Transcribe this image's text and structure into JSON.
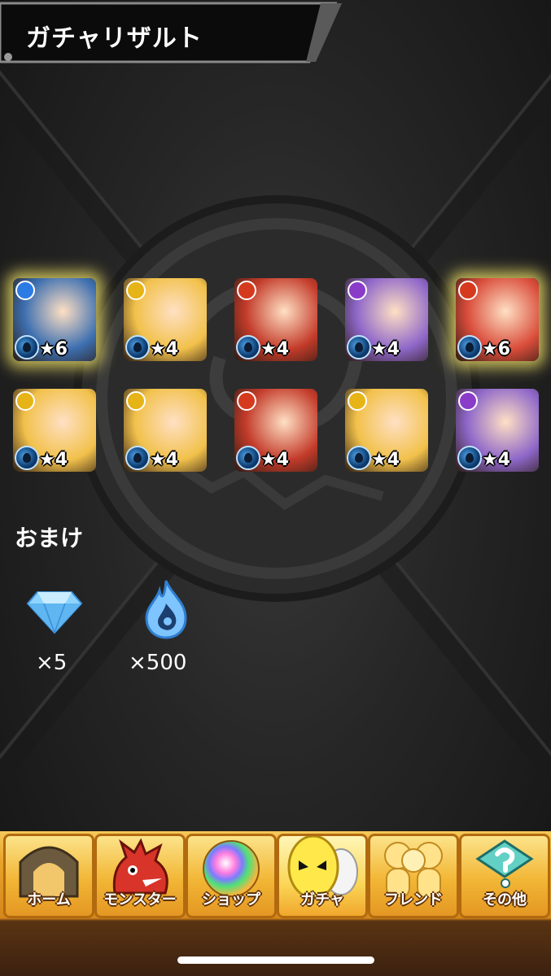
{
  "header": {
    "title": "ガチャリザルト"
  },
  "results": [
    {
      "rarity": "★6",
      "attribute": "water",
      "attr_color": "#2c7be5",
      "bg": "#3d6fb0",
      "glow": true
    },
    {
      "rarity": "★4",
      "attribute": "light",
      "attr_color": "#e6b416",
      "bg": "#f2c14b",
      "glow": false
    },
    {
      "rarity": "★4",
      "attribute": "fire",
      "attr_color": "#d63a1e",
      "bg": "#c33b2a",
      "glow": false
    },
    {
      "rarity": "★4",
      "attribute": "dark",
      "attr_color": "#8a3cc9",
      "bg": "#8e67c9",
      "glow": false
    },
    {
      "rarity": "★6",
      "attribute": "fire",
      "attr_color": "#d63a1e",
      "bg": "#d94c3a",
      "glow": true
    },
    {
      "rarity": "★4",
      "attribute": "light",
      "attr_color": "#e6b416",
      "bg": "#f2c14b",
      "glow": false
    },
    {
      "rarity": "★4",
      "attribute": "light",
      "attr_color": "#e6b416",
      "bg": "#f2c14b",
      "glow": false
    },
    {
      "rarity": "★4",
      "attribute": "fire",
      "attr_color": "#d63a1e",
      "bg": "#c33b2a",
      "glow": false
    },
    {
      "rarity": "★4",
      "attribute": "light",
      "attr_color": "#e6b416",
      "bg": "#f2c14b",
      "glow": false
    },
    {
      "rarity": "★4",
      "attribute": "dark",
      "attr_color": "#8a3cc9",
      "bg": "#8e67c9",
      "glow": false
    }
  ],
  "bonus": {
    "title": "おまけ",
    "items": [
      {
        "icon": "diamond-icon",
        "count": "×5"
      },
      {
        "icon": "blue-flame-icon",
        "count": "×500"
      }
    ]
  },
  "tabs": [
    {
      "label": "ホーム",
      "icon": "gate-icon"
    },
    {
      "label": "モンスター",
      "icon": "dragon-icon"
    },
    {
      "label": "ショップ",
      "icon": "rainbow-orb-icon"
    },
    {
      "label": "ガチャ",
      "icon": "egg-icon",
      "active": true
    },
    {
      "label": "フレンド",
      "icon": "friends-icon"
    },
    {
      "label": "その他",
      "icon": "question-icon"
    }
  ],
  "colors": {
    "tab_gold": "#f2b635",
    "glow": "#fff06e"
  }
}
